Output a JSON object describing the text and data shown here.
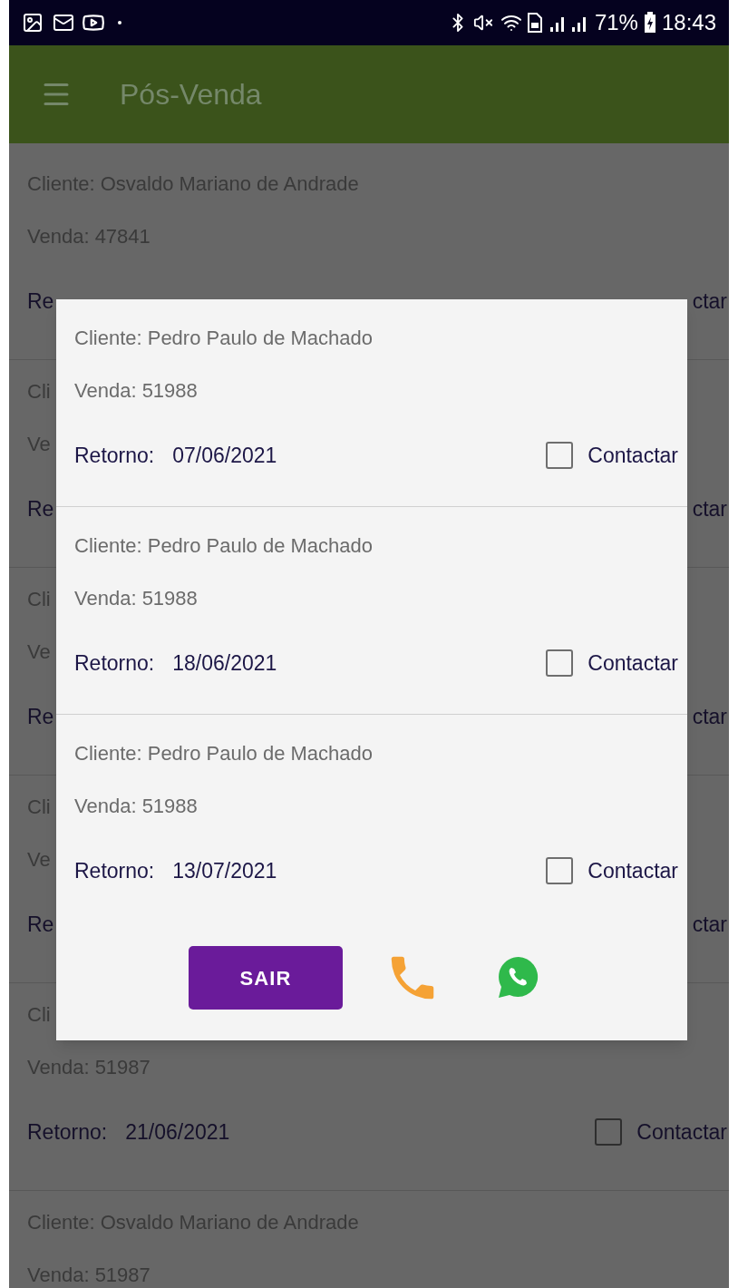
{
  "status_bar": {
    "battery": "71%",
    "time": "18:43"
  },
  "app_bar": {
    "title": "Pós-Venda"
  },
  "background_list": [
    {
      "cliente": "Cliente: Osvaldo Mariano de Andrade",
      "venda": "Venda: 47841",
      "retorno_label": "Re",
      "contact": {
        "label": "ctar"
      }
    },
    {
      "cliente": "Cli",
      "venda": "Ve",
      "retorno_label": "Re",
      "contact": {
        "label": "ctar"
      }
    },
    {
      "cliente": "Cli",
      "venda": "Ve",
      "retorno_label": "Re",
      "contact": {
        "label": "ctar"
      }
    },
    {
      "cliente": "Cli",
      "venda": "Ve",
      "retorno_label": "Re",
      "contact": {
        "label": "ctar"
      }
    },
    {
      "cliente": "Cli",
      "venda": "Venda: 51987",
      "retorno_label": "Retorno:",
      "date": "21/06/2021",
      "contact": {
        "label": "Contactar",
        "checked": false
      }
    },
    {
      "cliente": "Cliente: Osvaldo Mariano de Andrade",
      "venda": "Venda: 51987"
    }
  ],
  "dialog": {
    "items": [
      {
        "cliente": "Cliente: Pedro Paulo de Machado",
        "venda": "Venda: 51988",
        "retorno_label": "Retorno:",
        "date": "07/06/2021",
        "contact": {
          "label": "Contactar",
          "checked": false
        }
      },
      {
        "cliente": "Cliente: Pedro Paulo de Machado",
        "venda": "Venda: 51988",
        "retorno_label": "Retorno:",
        "date": "18/06/2021",
        "contact": {
          "label": "Contactar",
          "checked": false
        }
      },
      {
        "cliente": "Cliente: Pedro Paulo de Machado",
        "venda": "Venda: 51988",
        "retorno_label": "Retorno:",
        "date": "13/07/2021",
        "contact": {
          "label": "Contactar",
          "checked": false
        }
      }
    ],
    "exit_button": "SAIR"
  }
}
